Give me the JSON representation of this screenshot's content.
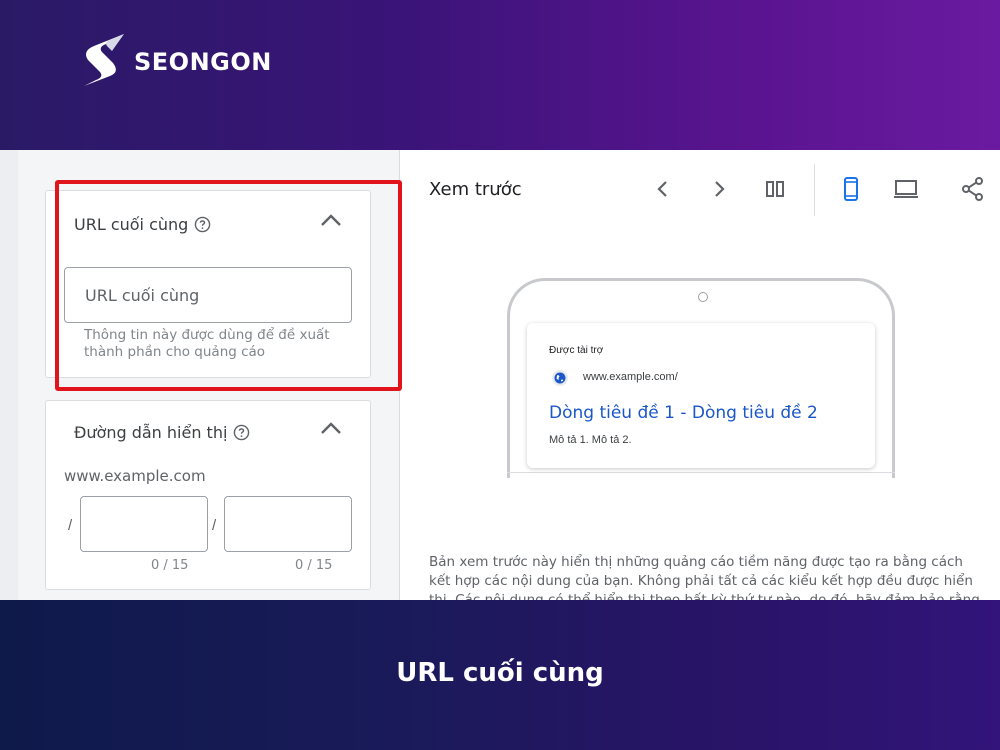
{
  "brand": {
    "name": "SEONGON"
  },
  "final_url_section": {
    "title": "URL cuối cùng",
    "input_placeholder": "URL cuối cùng",
    "input_value": "",
    "helper_text": "Thông tin này được dùng để đề xuất thành phần cho quảng cáo"
  },
  "display_path_section": {
    "title": "Đường dẫn hiển thị",
    "domain": "www.example.com",
    "separator": "/",
    "path1": {
      "value": "",
      "counter": "0 / 15"
    },
    "path2": {
      "value": "",
      "counter": "0 / 15"
    }
  },
  "preview": {
    "title": "Xem trước",
    "toolbar_icons": [
      "chevron-left-icon",
      "chevron-right-icon",
      "columns-icon",
      "mobile-icon",
      "desktop-icon",
      "share-icon"
    ],
    "active_device": "mobile",
    "ad": {
      "sponsored_label": "Được tài trợ",
      "url": "www.example.com/",
      "headline": "Dòng tiêu đề 1 - Dòng tiêu đề 2",
      "description": "Mô tả 1. Mô tả 2."
    },
    "disclaimer": "Bản xem trước này hiển thị những quảng cáo tiềm năng được tạo ra bằng cách kết hợp các nội dung của bạn. Không phải tất cả các kiểu kết hợp đều được hiển thị. Các nội dung có thể hiển thị theo bất kỳ thứ tự nào, do đó, hãy đảm bảo rằng các"
  },
  "caption": "URL cuối cùng",
  "colors": {
    "highlight": "#e0141a",
    "link_blue": "#1a57c8",
    "active_icon": "#1a73e8",
    "icon_gray": "#5f6368"
  }
}
